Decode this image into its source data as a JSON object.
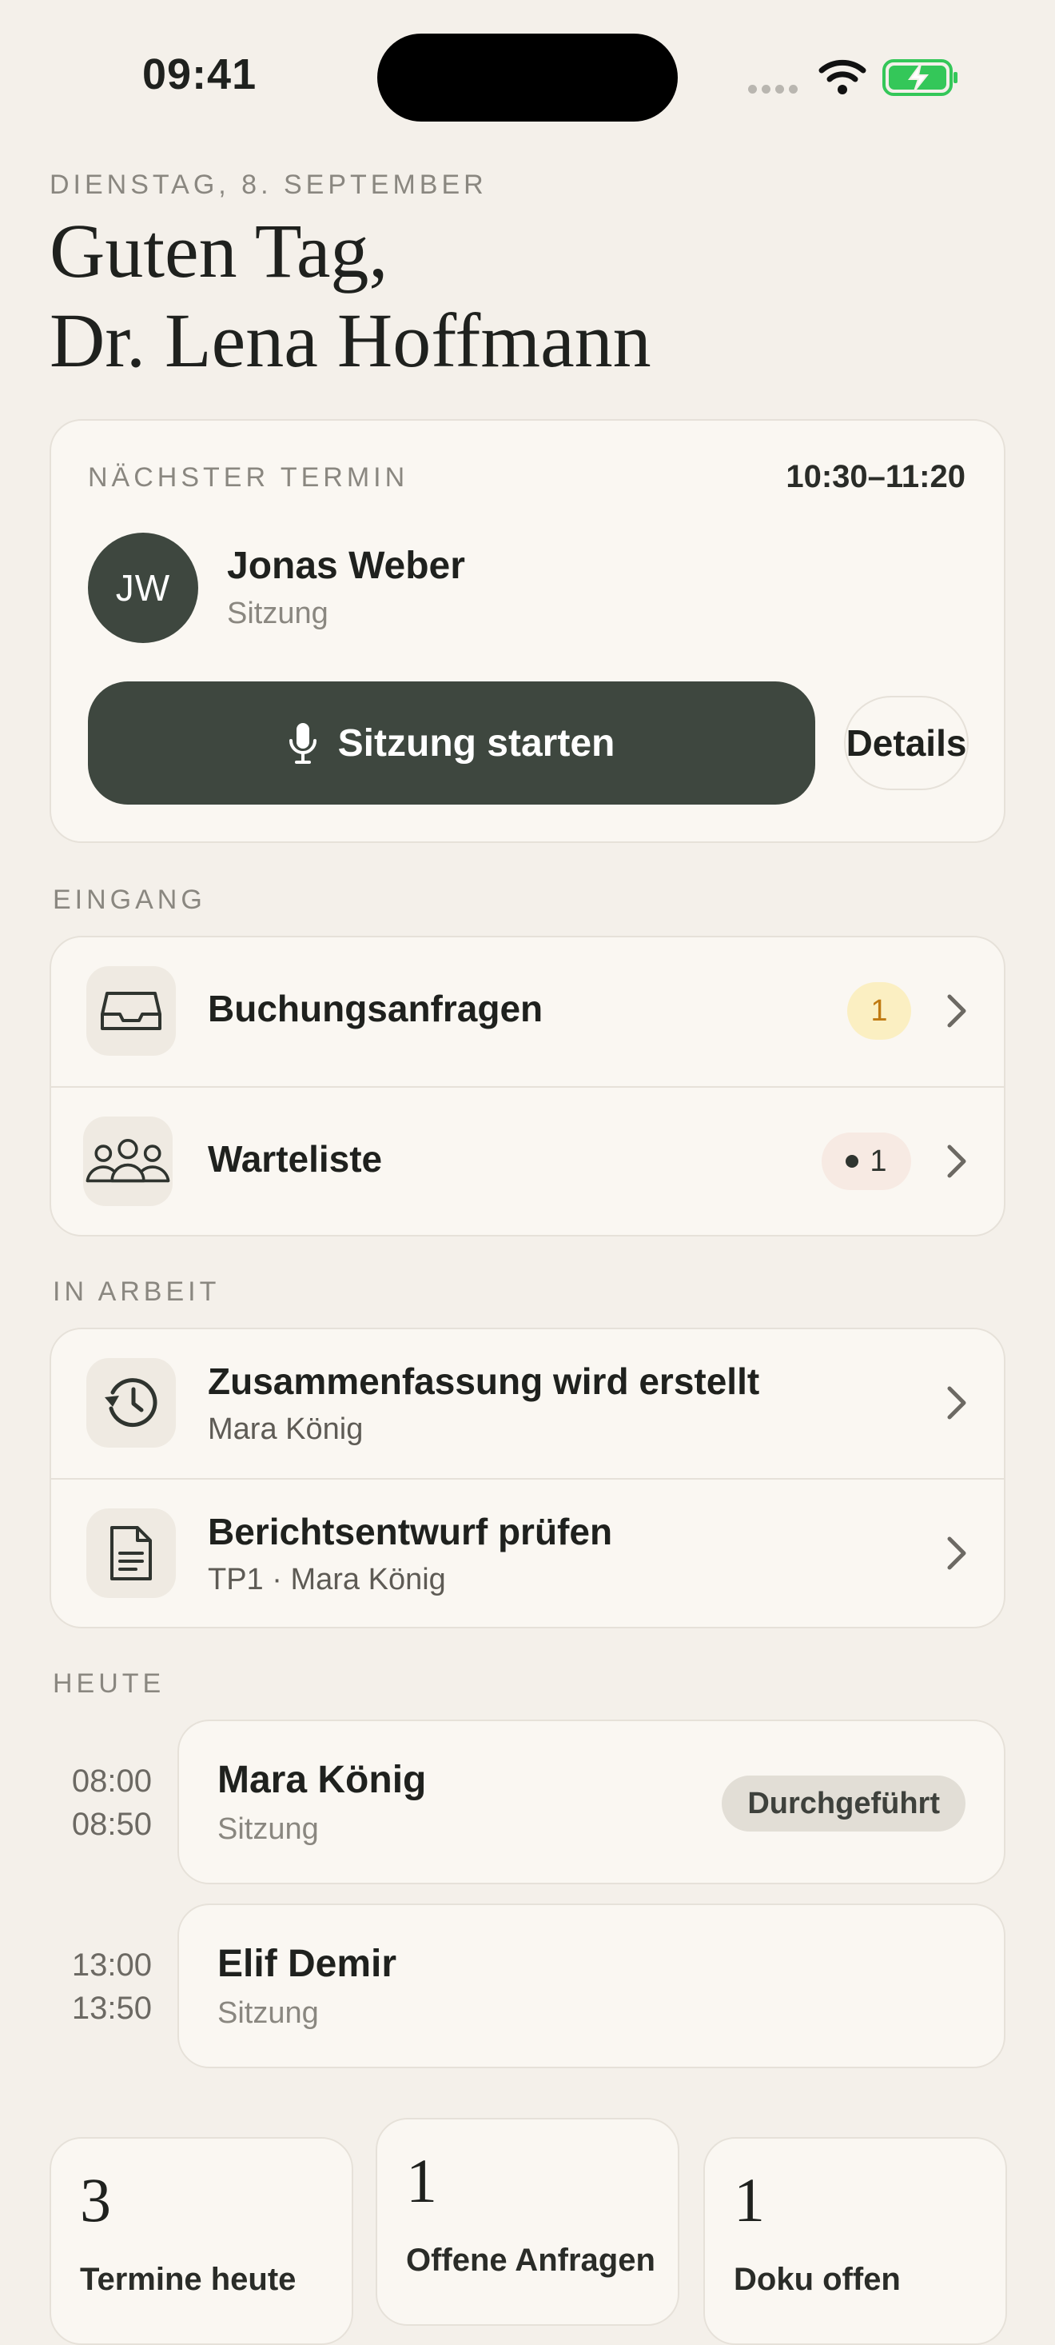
{
  "status_bar": {
    "time": "09:41"
  },
  "header": {
    "date": "DIENSTAG, 8. SEPTEMBER",
    "greeting_line1": "Guten Tag,",
    "greeting_line2": "Dr. Lena Hoffmann"
  },
  "next_appointment": {
    "label": "NÄCHSTER TERMIN",
    "time": "10:30–11:20",
    "initials": "JW",
    "patient": "Jonas Weber",
    "type": "Sitzung",
    "start_label": "Sitzung starten",
    "details_label": "Details"
  },
  "inbox": {
    "label": "EINGANG",
    "items": [
      {
        "title": "Buchungsanfragen",
        "badge": "1",
        "icon": "inbox-tray-icon"
      },
      {
        "title": "Warteliste",
        "badge": "1",
        "icon": "group-icon"
      }
    ]
  },
  "in_progress": {
    "label": "IN ARBEIT",
    "items": [
      {
        "title": "Zusammenfassung wird erstellt",
        "subtitle": "Mara König",
        "icon": "history-icon"
      },
      {
        "title": "Berichtsentwurf prüfen",
        "subtitle": "TP1 · Mara König",
        "icon": "document-icon"
      }
    ]
  },
  "today": {
    "label": "HEUTE",
    "appointments": [
      {
        "start": "08:00",
        "end": "08:50",
        "name": "Mara König",
        "type": "Sitzung",
        "status": "Durchgeführt"
      },
      {
        "start": "13:00",
        "end": "13:50",
        "name": "Elif Demir",
        "type": "Sitzung"
      }
    ]
  },
  "stats": [
    {
      "value": "3",
      "label": "Termine heute"
    },
    {
      "value": "1",
      "label": "Offene Anfragen"
    },
    {
      "value": "1",
      "label": "Doku offen"
    }
  ],
  "colors": {
    "background": "#F4F0EA",
    "card": "#FAF7F2",
    "accent": "#3E473F",
    "badge_yellow": "#FBEFC2",
    "badge_yellow_text": "#C07A12",
    "badge_pink": "#F7EAE3"
  }
}
